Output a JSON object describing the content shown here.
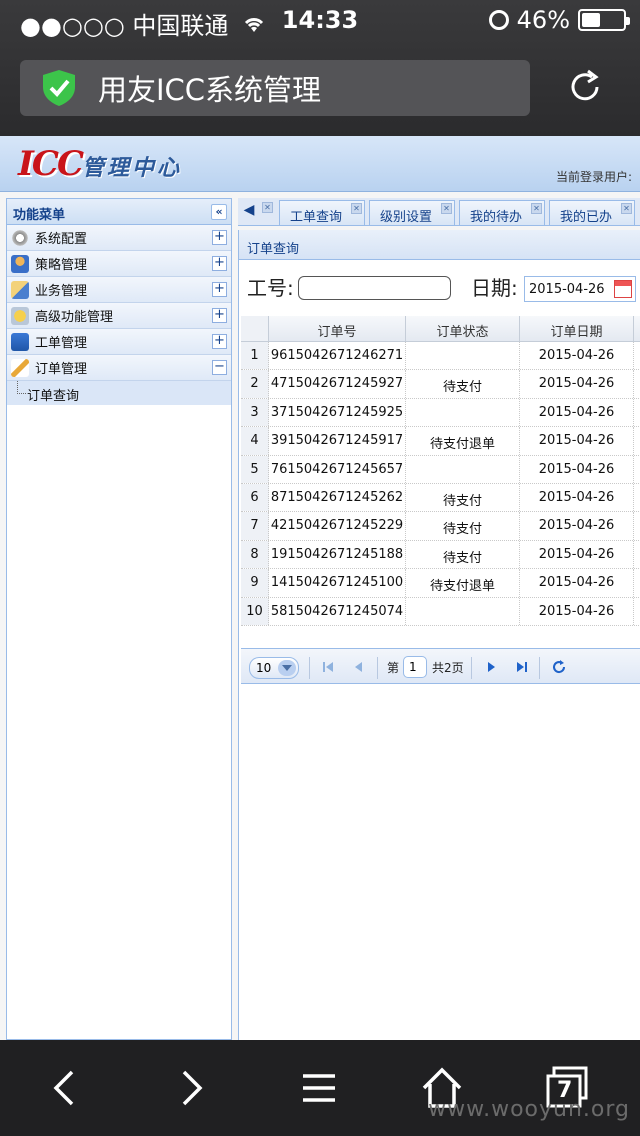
{
  "status_bar": {
    "carrier": "●●○○○ 中国联通",
    "time": "14:33",
    "battery": "46%",
    "battery_level": 0.46
  },
  "browser": {
    "title": "用友ICC系统管理"
  },
  "app": {
    "logo_text": "ICC",
    "logo_subtitle": "管理中心",
    "login_user": "当前登录用户:"
  },
  "menu": {
    "title": "功能菜单",
    "items": [
      {
        "label": "系统配置",
        "icon": "gear-icon",
        "expanded": false
      },
      {
        "label": "策略管理",
        "icon": "user-icon",
        "expanded": false
      },
      {
        "label": "业务管理",
        "icon": "document-icon",
        "expanded": false
      },
      {
        "label": "高级功能管理",
        "icon": "star-icon",
        "expanded": false
      },
      {
        "label": "工单管理",
        "icon": "edit-icon",
        "expanded": false
      },
      {
        "label": "订单管理",
        "icon": "pencil-icon",
        "expanded": true
      }
    ],
    "sub_items": [
      {
        "label": "订单查询"
      }
    ]
  },
  "tabs": [
    {
      "label": "工单查询"
    },
    {
      "label": "级别设置"
    },
    {
      "label": "我的待办"
    },
    {
      "label": "我的已办"
    }
  ],
  "panel": {
    "title": "订单查询",
    "search": {
      "job_no_label": "工号:",
      "job_no_value": "",
      "date_label": "日期:",
      "date_value": "2015-04-26"
    }
  },
  "grid": {
    "columns": [
      "订单号",
      "订单状态",
      "订单日期"
    ],
    "rows": [
      {
        "rn": "1",
        "order_no": "9615042671246271",
        "status": "",
        "date": "2015-04-26"
      },
      {
        "rn": "2",
        "order_no": "4715042671245927",
        "status": "待支付",
        "date": "2015-04-26"
      },
      {
        "rn": "3",
        "order_no": "3715042671245925",
        "status": "",
        "date": "2015-04-26"
      },
      {
        "rn": "4",
        "order_no": "3915042671245917",
        "status": "待支付退单",
        "date": "2015-04-26"
      },
      {
        "rn": "5",
        "order_no": "7615042671245657",
        "status": "",
        "date": "2015-04-26"
      },
      {
        "rn": "6",
        "order_no": "8715042671245262",
        "status": "待支付",
        "date": "2015-04-26"
      },
      {
        "rn": "7",
        "order_no": "4215042671245229",
        "status": "待支付",
        "date": "2015-04-26"
      },
      {
        "rn": "8",
        "order_no": "1915042671245188",
        "status": "待支付",
        "date": "2015-04-26"
      },
      {
        "rn": "9",
        "order_no": "1415042671245100",
        "status": "待支付退单",
        "date": "2015-04-26"
      },
      {
        "rn": "10",
        "order_no": "5815042671245074",
        "status": "",
        "date": "2015-04-26"
      }
    ]
  },
  "pager": {
    "page_size": "10",
    "page_prefix": "第",
    "page_value": "1",
    "page_total": "共2页"
  },
  "bottom_bar": {
    "tabs_count": "7",
    "watermark": "www.wooyun.org"
  }
}
